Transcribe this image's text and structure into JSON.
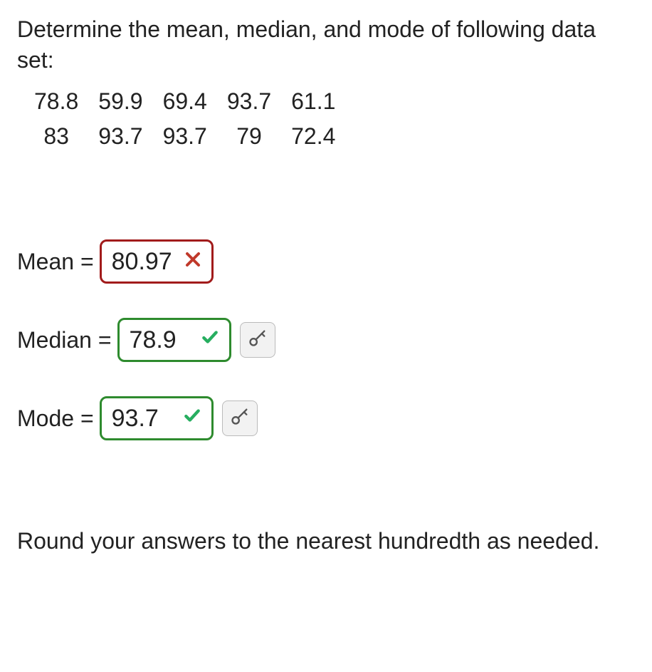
{
  "question": "Determine the mean, median, and mode of following data set:",
  "data_rows": [
    [
      "78.8",
      "59.9",
      "69.4",
      "93.7",
      "61.1"
    ],
    [
      "83",
      "93.7",
      "93.7",
      "79",
      "72.4"
    ]
  ],
  "answers": {
    "mean": {
      "label": "Mean =",
      "value": "80.97",
      "status": "incorrect"
    },
    "median": {
      "label": "Median =",
      "value": "78.9",
      "status": "correct"
    },
    "mode": {
      "label": "Mode =",
      "value": "93.7",
      "status": "correct"
    }
  },
  "footer": "Round your answers to the nearest hundredth as needed."
}
